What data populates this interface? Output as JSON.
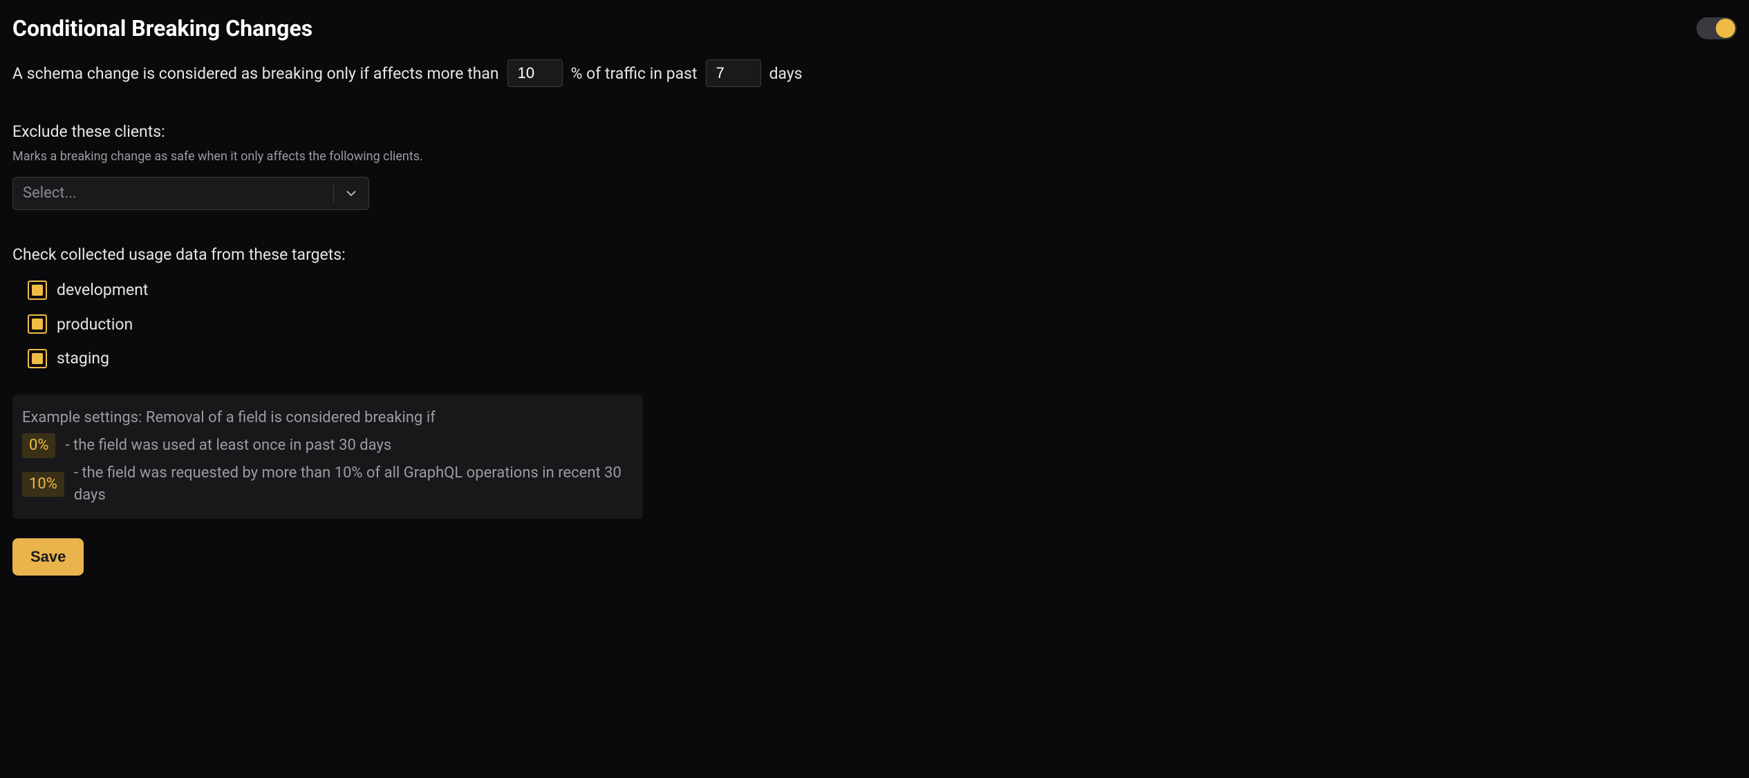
{
  "header": {
    "title": "Conditional Breaking Changes",
    "toggle_on": true
  },
  "sentence": {
    "before_pct": "A schema change is considered as breaking only if affects more than",
    "percent_value": "10",
    "middle": "% of traffic in past",
    "days_value": "7",
    "after_days": "days"
  },
  "exclude": {
    "label": "Exclude these clients:",
    "sub": "Marks a breaking change as safe when it only affects the following clients.",
    "placeholder": "Select..."
  },
  "targets": {
    "label": "Check collected usage data from these targets:",
    "items": [
      {
        "label": "development",
        "checked": true
      },
      {
        "label": "production",
        "checked": true
      },
      {
        "label": "staging",
        "checked": true
      }
    ]
  },
  "example": {
    "intro": "Example settings: Removal of a field is considered breaking if",
    "rows": [
      {
        "pct": "0%",
        "text": "- the field was used at least once in past 30 days"
      },
      {
        "pct": "10%",
        "text": "- the field was requested by more than 10% of all GraphQL operations in recent 30 days"
      }
    ]
  },
  "actions": {
    "save": "Save"
  }
}
